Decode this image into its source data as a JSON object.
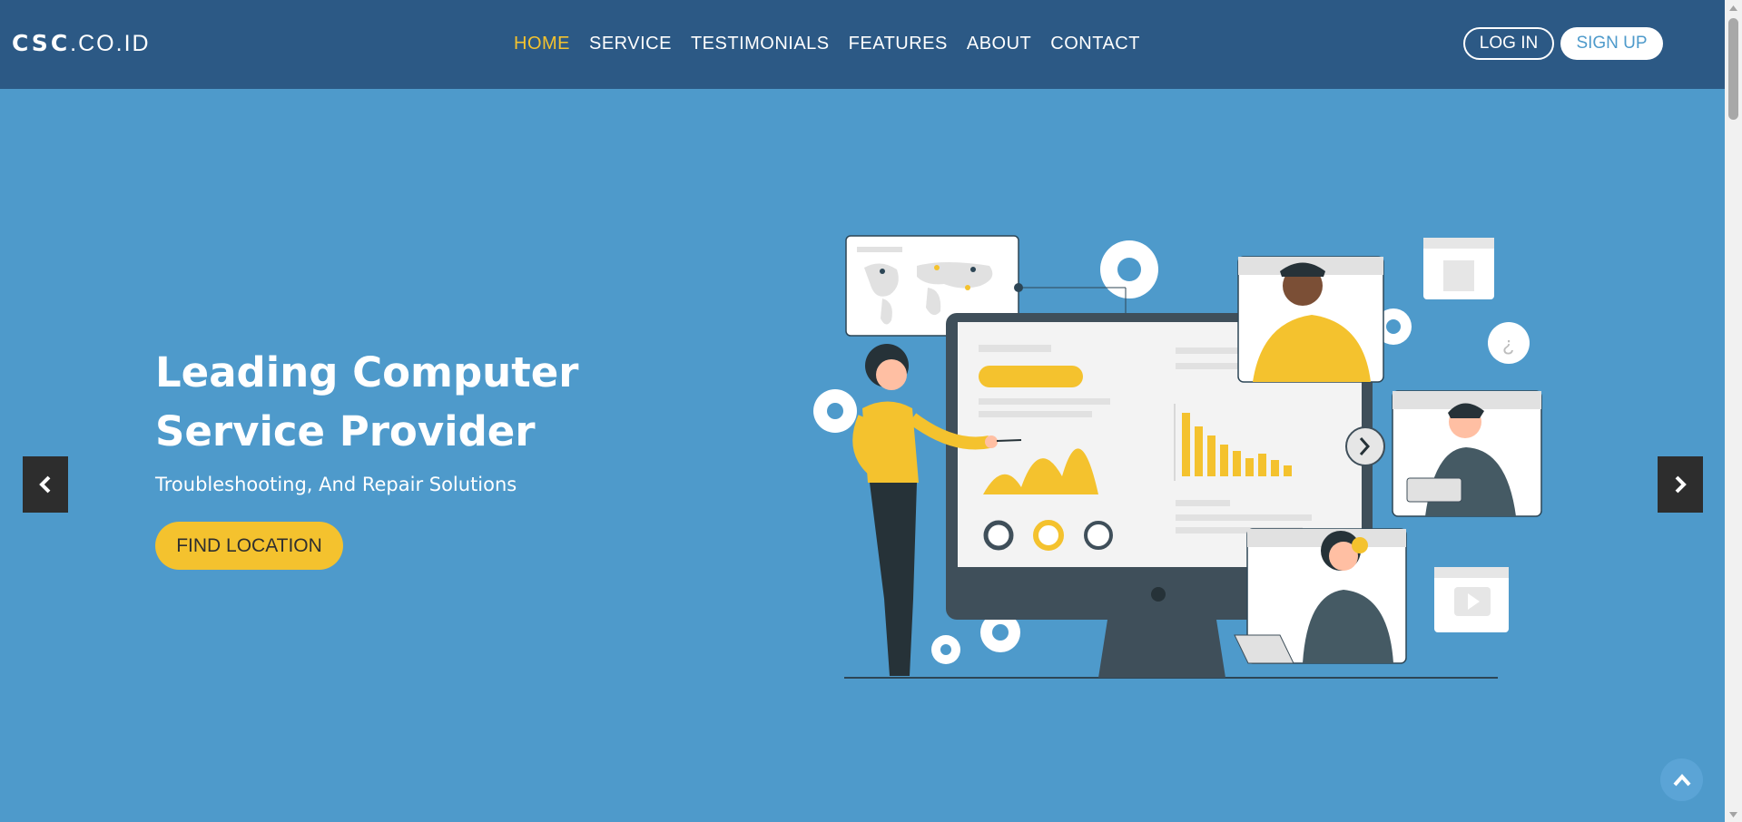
{
  "brand": {
    "bold": "CSC",
    "rest": ".CO.ID"
  },
  "nav": {
    "items": [
      {
        "label": "HOME",
        "active": true
      },
      {
        "label": "SERVICE",
        "active": false
      },
      {
        "label": "TESTIMONIALS",
        "active": false
      },
      {
        "label": "FEATURES",
        "active": false
      },
      {
        "label": "ABOUT",
        "active": false
      },
      {
        "label": "CONTACT",
        "active": false
      }
    ],
    "login_label": "LOG IN",
    "signup_label": "SIGN UP"
  },
  "hero": {
    "title_line1": "Leading Computer",
    "title_line2": "Service Provider",
    "subtitle": "Troubleshooting, And Repair Solutions",
    "cta_label": "FIND LOCATION"
  },
  "icons": {
    "prev": "chevron-left-icon",
    "next": "chevron-right-icon",
    "back_to_top": "chevron-up-icon"
  },
  "colors": {
    "navbar": "#2c5985",
    "hero_bg": "#4e9acb",
    "accent": "#f4c22e",
    "white": "#ffffff"
  }
}
